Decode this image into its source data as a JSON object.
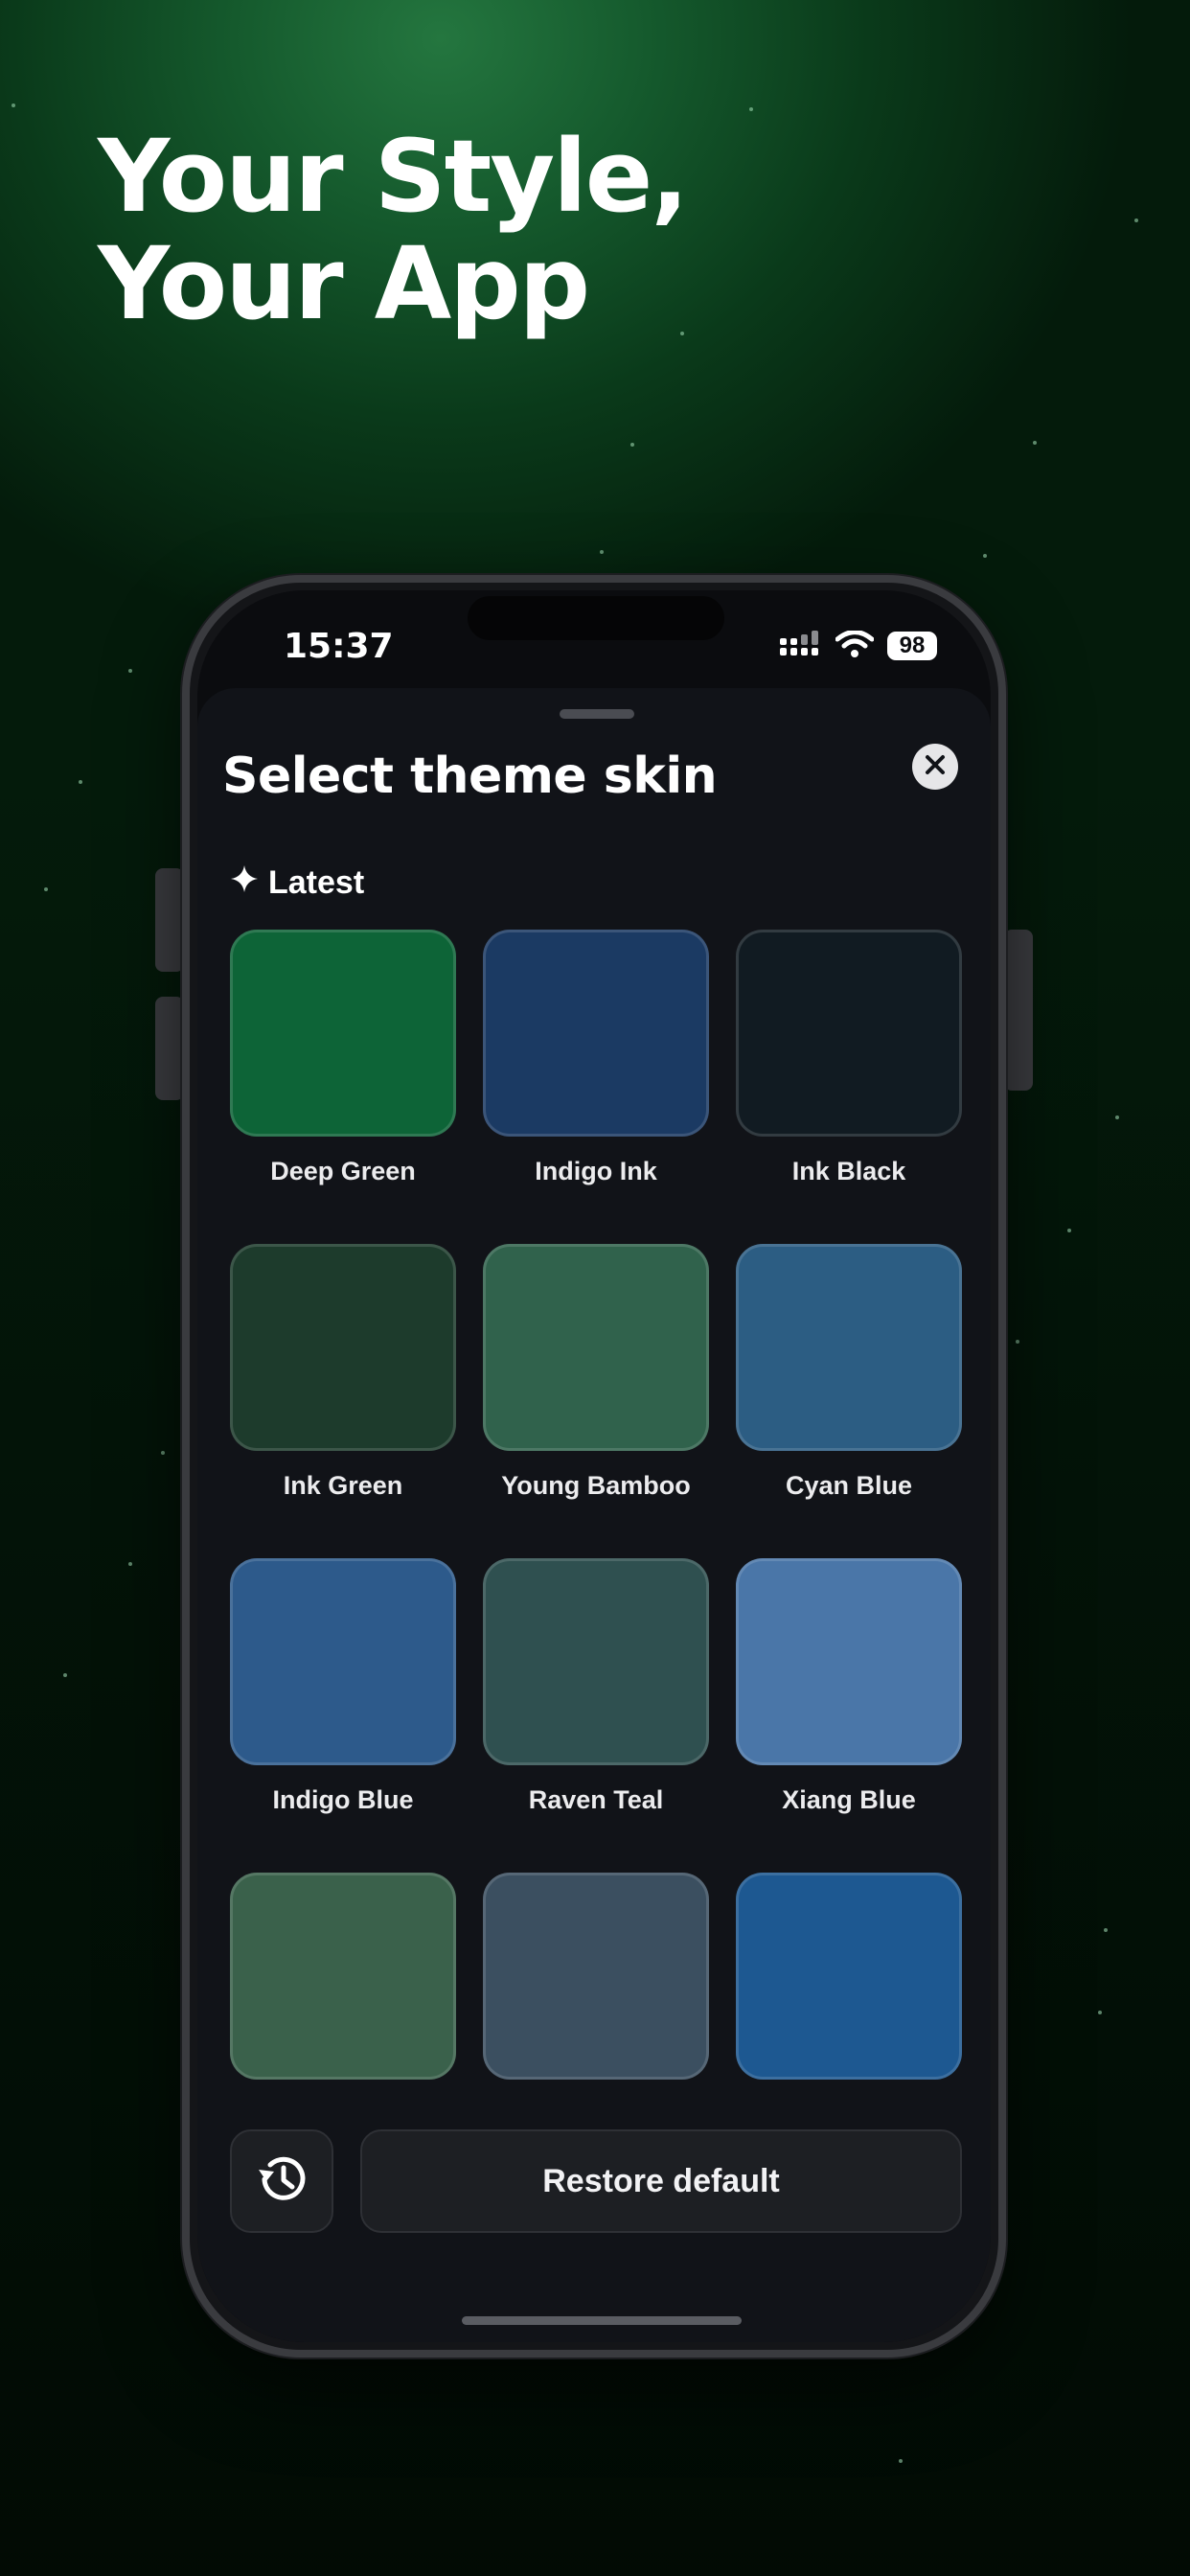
{
  "headline": {
    "line1": "Your Style,",
    "line2": "Your App"
  },
  "status_bar": {
    "time": "15:37",
    "battery": "98"
  },
  "sheet": {
    "title": "Select theme skin",
    "section_label": "Latest",
    "themes": [
      {
        "name": "Deep Green",
        "color": "#0d6437"
      },
      {
        "name": "Indigo Ink",
        "color": "#1b3a63"
      },
      {
        "name": "Ink Black",
        "color": "#111b22"
      },
      {
        "name": "Ink Green",
        "color": "#1d3b2c"
      },
      {
        "name": "Young Bamboo",
        "color": "#30624c"
      },
      {
        "name": "Cyan Blue",
        "color": "#2c5d83"
      },
      {
        "name": "Indigo Blue",
        "color": "#2d5a8b"
      },
      {
        "name": "Raven Teal",
        "color": "#2f5050"
      },
      {
        "name": "Xiang Blue",
        "color": "#4a76a8"
      },
      {
        "name": "",
        "color": "#3a614b"
      },
      {
        "name": "",
        "color": "#3b4f60"
      },
      {
        "name": "",
        "color": "#1d5891"
      }
    ],
    "restore_label": "Restore default"
  },
  "icons": {
    "close": "close-icon",
    "sparkle": "sparkle-icon",
    "history": "history-icon",
    "signal": "signal-icon",
    "wifi": "wifi-icon",
    "battery": "battery-icon"
  }
}
